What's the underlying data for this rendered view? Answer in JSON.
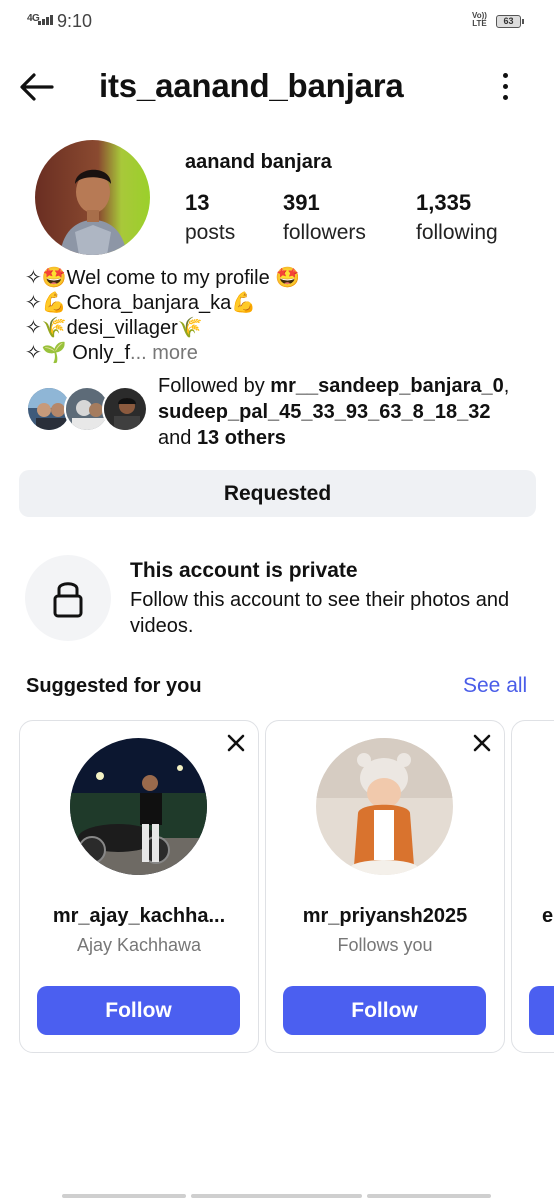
{
  "status_bar": {
    "network": "4G",
    "time": "9:10",
    "volte_top": "Vo))",
    "volte_bottom": "LTE",
    "battery": "63"
  },
  "header": {
    "username": "its_aanand_banjara",
    "back_icon": "arrow-left-icon",
    "menu_icon": "more-vertical-icon"
  },
  "profile": {
    "display_name": "aanand banjara",
    "stats": [
      {
        "value": "13",
        "label": "posts"
      },
      {
        "value": "391",
        "label": "followers"
      },
      {
        "value": "1,335",
        "label": "following"
      }
    ],
    "bio_lines": [
      "✧🤩Wel come to my profile 🤩",
      "✧💪Chora_banjara_ka💪",
      "✧🌾desi_villager🌾",
      "✧🌱 Only_f"
    ],
    "bio_more": "... more",
    "followed_by_prefix": "Followed by ",
    "followed_by_user1": "mr__sandeep_banjara_0",
    "followed_by_sep": ",",
    "followed_by_user2": "sudeep_pal_45_33_93_63_8_18_32",
    "followed_by_and": "and ",
    "followed_by_others": "13 others"
  },
  "actions": {
    "requested_label": "Requested"
  },
  "private_notice": {
    "icon": "lock-icon",
    "title": "This account is private",
    "description": "Follow this account to see their photos and videos."
  },
  "suggested": {
    "title": "Suggested for you",
    "see_all": "See all",
    "cards": [
      {
        "username": "mr_ajay_kachha...",
        "subtitle": "Ajay Kachhawa",
        "button": "Follow"
      },
      {
        "username": "mr_priyansh2025",
        "subtitle": "Follows you",
        "button": "Follow"
      },
      {
        "username": "e",
        "subtitle": "",
        "button": ""
      }
    ]
  },
  "colors": {
    "accent": "#4b5ff0",
    "link": "#4a5de8",
    "secondary_button": "#eff1f4"
  }
}
